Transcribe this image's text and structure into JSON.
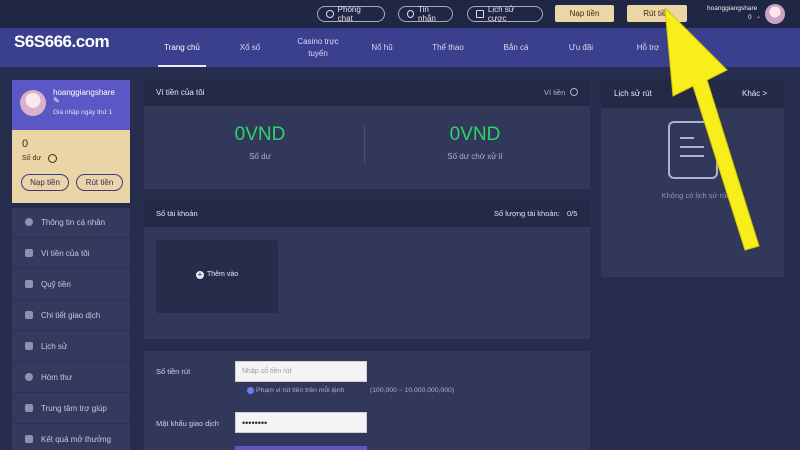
{
  "topbar": {
    "phong_chat": "Phòng chat",
    "tin_nhan": "Tin nhắn",
    "lich_su_cuoc": "Lịch sử cược",
    "nap_tien": "Nạp tiền",
    "rut_tien": "Rút tiền",
    "username": "hoanggiangshare",
    "balance": "0"
  },
  "brand": {
    "logo_text": "S6S666.com"
  },
  "nav": [
    {
      "label": "Trang chủ"
    },
    {
      "label": "Xổ số"
    },
    {
      "label": "Casino trực tuyến"
    },
    {
      "label": "Nổ hũ"
    },
    {
      "label": "Thể thao"
    },
    {
      "label": "Bắn cá"
    },
    {
      "label": "Ưu đãi"
    },
    {
      "label": "Hỗ trợ"
    }
  ],
  "user": {
    "name": "hoanggiangshare",
    "joined": "Gia nhập ngày thứ 1",
    "balance": "0",
    "balance_label": "Số dư",
    "deposit": "Nạp tiền",
    "withdraw": "Rút tiền"
  },
  "menu": [
    {
      "label": "Thông tin cá nhân"
    },
    {
      "label": "Ví tiền của tôi"
    },
    {
      "label": "Quỹ tiền"
    },
    {
      "label": "Chi tiết giao dịch"
    },
    {
      "label": "Lịch sử"
    },
    {
      "label": "Hòm thư"
    },
    {
      "label": "Trung tâm trợ giúp"
    },
    {
      "label": "Kết quả mở thưởng"
    }
  ],
  "wallet": {
    "title": "Ví tiền của tôi",
    "right_link": "Ví tiền",
    "balance_value": "0VND",
    "balance_label": "Số dư",
    "pending_value": "0VND",
    "pending_label": "Số dư chờ xử lí"
  },
  "accounts": {
    "title": "Số tài khoản",
    "count_label": "Số lượng tài khoản:",
    "count": "0/5",
    "add": "Thêm vào"
  },
  "withdraw_form": {
    "amount_label": "Số tiền rút",
    "amount_placeholder": "Nhập số tiền rút",
    "range_note": "Phạm vi rút tiền trên mỗi lệnh",
    "range_value": "(100,000 ~ 10,000,000,000)",
    "password_label": "Mật khẩu giao dịch",
    "password_value": "••••••••"
  },
  "history": {
    "title": "Lịch sử rút",
    "more": "Khác >",
    "empty": "Không có lịch sử rút"
  },
  "colors": {
    "accent_green": "#2fd36a",
    "gold": "#ecd6a6",
    "nav_purple": "#3a3f8e",
    "arrow_yellow": "#f7ee1c"
  }
}
